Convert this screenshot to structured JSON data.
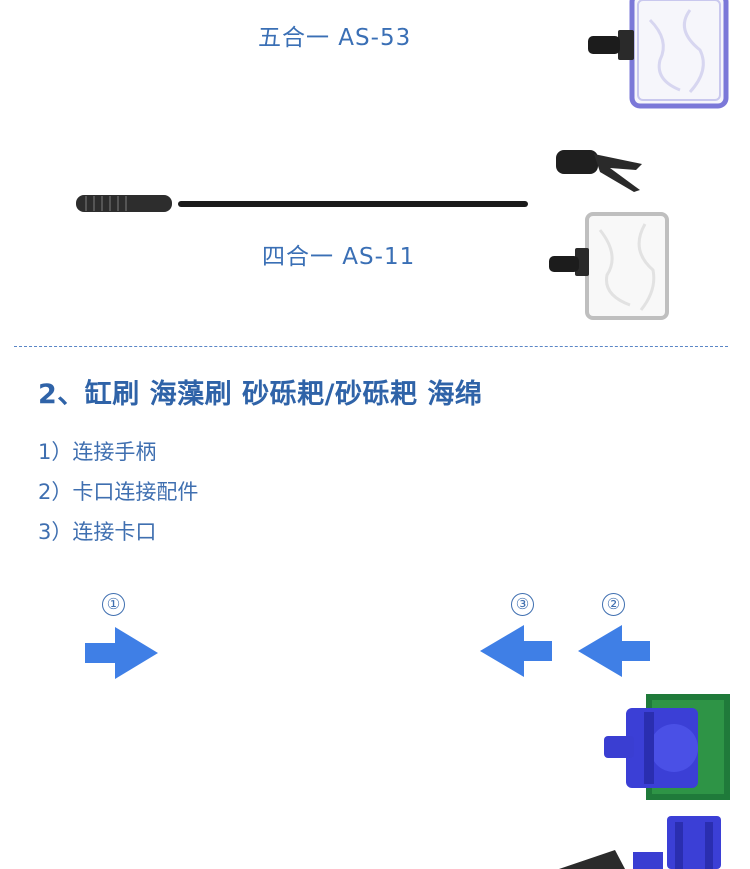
{
  "products": {
    "five_in_one": {
      "caption": "五合一 AS-53"
    },
    "four_in_one": {
      "caption": "四合一 AS-11"
    }
  },
  "section2": {
    "title": "2、缸刷 海藻刷 砂砾耙/砂砾耙 海绵",
    "steps": [
      "1）连接手柄",
      "2）卡口连接配件",
      "3）连接卡口"
    ]
  },
  "diagram": {
    "markers": [
      "①",
      "③",
      "②"
    ],
    "arrow_color": "#3f7fe6"
  }
}
